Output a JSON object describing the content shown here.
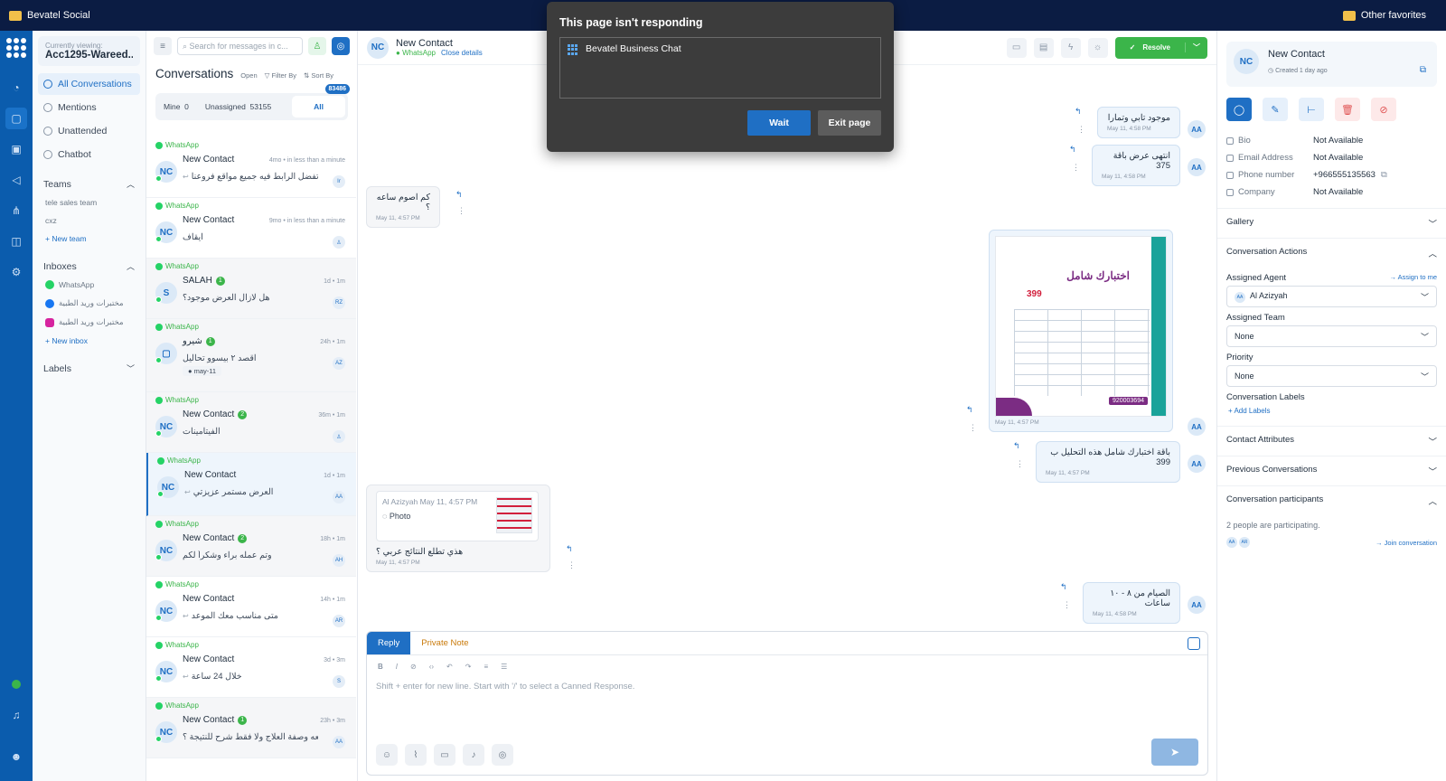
{
  "browser": {
    "left_folder": "Bevatel Social",
    "right_folder": "Other favorites"
  },
  "nav": {
    "viewing_label": "Currently viewing:",
    "account": "Acc1295-Wareed...",
    "items": [
      {
        "label": "All Conversations"
      },
      {
        "label": "Mentions"
      },
      {
        "label": "Unattended"
      },
      {
        "label": "Chatbot"
      }
    ],
    "teams_label": "Teams",
    "teams": [
      "tele sales team",
      "cxz"
    ],
    "new_team": "+ New team",
    "inboxes_label": "Inboxes",
    "inboxes": [
      "WhatsApp",
      "مختبرات وريد الطبية",
      "مختبرات وريد الطبية"
    ],
    "new_inbox": "+ New inbox",
    "labels_label": "Labels"
  },
  "list": {
    "search_placeholder": "Search for messages in c...",
    "title": "Conversations",
    "status": "Open",
    "filter": "Filter By",
    "sort": "Sort By",
    "tab_mine": "Mine",
    "mine_count": "0",
    "tab_unassigned": "Unassigned",
    "unassigned_count": "53155",
    "tab_all": "All",
    "all_count": "83486",
    "items": [
      {
        "source": "WhatsApp",
        "initials": "NC",
        "name": "New Contact",
        "unread": "",
        "time": "4mo • in less than a minute",
        "msg": "تفضل الرابط فيه جميع مواقع فروعنا",
        "tag": "Ir",
        "label": ""
      },
      {
        "source": "WhatsApp",
        "initials": "NC",
        "name": "New Contact",
        "unread": "",
        "time": "9mo • in less than a minute",
        "msg": "ايقاف",
        "tag": "",
        "label": ""
      },
      {
        "source": "WhatsApp",
        "initials": "S",
        "name": "SALAH",
        "unread": "1",
        "time": "1d • 1m",
        "msg": "هل لازال العرض موجود؟",
        "tag": "RZ",
        "label": ""
      },
      {
        "source": "WhatsApp",
        "initials": "",
        "name": "شيرو",
        "unread": "1",
        "time": "24h • 1m",
        "msg": "اقصد ٢ بيسوو تحاليل",
        "tag": "AZ",
        "label": "may-11"
      },
      {
        "source": "WhatsApp",
        "initials": "NC",
        "name": "New Contact",
        "unread": "2",
        "time": "36m • 1m",
        "msg": "الفيتامينات",
        "tag": "",
        "label": ""
      },
      {
        "source": "WhatsApp",
        "initials": "NC",
        "name": "New Contact",
        "unread": "",
        "time": "1d • 1m",
        "msg": "العرض مستمر عزيزتي",
        "tag": "AA",
        "label": ""
      },
      {
        "source": "WhatsApp",
        "initials": "NC",
        "name": "New Contact",
        "unread": "2",
        "time": "18h • 1m",
        "msg": "وتم عمله براء وشكراً لكم",
        "tag": "AH",
        "label": ""
      },
      {
        "source": "WhatsApp",
        "initials": "NC",
        "name": "New Contact",
        "unread": "",
        "time": "14h • 1m",
        "msg": "متى مناسب معك الموعد",
        "tag": "AR",
        "label": ""
      },
      {
        "source": "WhatsApp",
        "initials": "NC",
        "name": "New Contact",
        "unread": "",
        "time": "3d • 3m",
        "msg": "خلال 24 ساعة",
        "tag": "S",
        "label": ""
      },
      {
        "source": "WhatsApp",
        "initials": "NC",
        "name": "New Contact",
        "unread": "1",
        "time": "23h • 3m",
        "msg": "ن معه وصفة العلاج ولا فقط شرح للنتيجة ؟...",
        "tag": "AA",
        "label": ""
      }
    ]
  },
  "chat": {
    "initials": "NC",
    "name": "New Contact",
    "channel": "WhatsApp",
    "close_details": "Close details",
    "resolve": "Resolve",
    "agent_initials": "AA",
    "messages": [
      {
        "text": "موجود تابي وتمارا",
        "time": "May 11, 4:58 PM"
      },
      {
        "text": "انتهى عرض باقة 375",
        "time": "May 11, 4:58 PM"
      },
      {
        "text": "كم اصوم ساعه ؟",
        "time": "May 11, 4:57 PM"
      },
      {
        "text": "باقة اختبارك شامل هذه التحليل ب 399",
        "time": "May 11, 4:57 PM"
      },
      {
        "text": "هذي تطلع النتائج عربي ؟",
        "time": "May 11, 4:57 PM"
      },
      {
        "text": "الصيام من ٨ - ١٠ ساعات",
        "time": "May 11, 4:58 PM"
      }
    ],
    "poster": {
      "title": "اختبارك شامل",
      "price": "399",
      "phone": "920003694",
      "time": "May 11, 4:57 PM"
    },
    "quote": {
      "author": "Al Azizyah May 11, 4:57 PM",
      "kind": "Photo"
    },
    "composer": {
      "reply_tab": "Reply",
      "note_tab": "Private Note",
      "placeholder": "Shift + enter for new line. Start with '/' to select a Canned Response."
    }
  },
  "panel": {
    "initials": "NC",
    "name": "New Contact",
    "created": "Created 1 day ago",
    "attrs": [
      {
        "k": "Bio",
        "v": "Not Available"
      },
      {
        "k": "Email Address",
        "v": "Not Available"
      },
      {
        "k": "Phone number",
        "v": "+966555135563"
      },
      {
        "k": "Company",
        "v": "Not Available"
      }
    ],
    "gallery": "Gallery",
    "actions": "Conversation Actions",
    "assigned_agent": "Assigned Agent",
    "assign_to_me": "→ Assign to me",
    "agent_initials": "AA",
    "agent": "Al Azizyah",
    "assigned_team": "Assigned Team",
    "team": "None",
    "priority": "Priority",
    "priority_value": "None",
    "conv_labels": "Conversation Labels",
    "add_labels": "+ Add Labels",
    "contact_attrs": "Contact Attributes",
    "previous": "Previous Conversations",
    "participants_title": "Conversation participants",
    "participants_text": "2 people are participating.",
    "participant_initials": [
      "AA",
      "AR"
    ],
    "join": "→ Join conversation"
  },
  "dialog": {
    "title": "This page isn't responding",
    "app": "Bevatel Business Chat",
    "wait": "Wait",
    "exit": "Exit page"
  }
}
